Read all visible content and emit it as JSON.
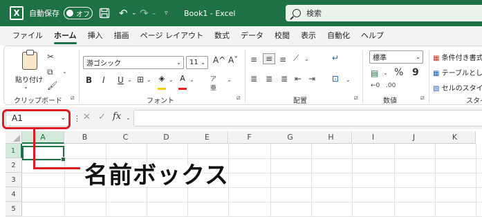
{
  "titlebar": {
    "logo_icon": "excel-logo-icon",
    "autosave_label": "自動保存",
    "autosave_state": "オフ",
    "save_icon": "save-icon",
    "undo_icon": "undo-icon",
    "redo_icon": "redo-icon",
    "book_title": "Book1 - Excel",
    "search_placeholder": "検索",
    "bg_color": "#1e7145"
  },
  "menu": {
    "tabs": [
      {
        "label": "ファイル",
        "active": false
      },
      {
        "label": "ホーム",
        "active": true
      },
      {
        "label": "挿入",
        "active": false
      },
      {
        "label": "描画",
        "active": false
      },
      {
        "label": "ページ レイアウト",
        "active": false
      },
      {
        "label": "数式",
        "active": false
      },
      {
        "label": "データ",
        "active": false
      },
      {
        "label": "校閲",
        "active": false
      },
      {
        "label": "表示",
        "active": false
      },
      {
        "label": "自動化",
        "active": false
      },
      {
        "label": "ヘルプ",
        "active": false
      }
    ]
  },
  "ribbon": {
    "clipboard": {
      "paste_label": "貼り付け",
      "group_label": "クリップボード"
    },
    "font": {
      "font_name": "游ゴシック",
      "font_size": "11",
      "bold": "B",
      "italic": "I",
      "underline": "U",
      "grow": "A^",
      "shrink": "Aˇ",
      "group_label": "フォント"
    },
    "alignment": {
      "group_label": "配置"
    },
    "number": {
      "format": "標準",
      "percent": "%",
      "comma": "9",
      "group_label": "数値"
    },
    "styles": {
      "conditional": "条件付き書式",
      "table": "テーブルとして",
      "cell_style": "セルのスタイル",
      "group_label": "スタイ"
    }
  },
  "formula_bar": {
    "name_box_value": "A1",
    "fx_label": "fx",
    "formula_value": ""
  },
  "grid": {
    "columns": [
      "A",
      "B",
      "C",
      "D",
      "E",
      "F",
      "G",
      "H",
      "I",
      "J",
      "K"
    ],
    "rows": [
      "1",
      "2",
      "3",
      "4",
      "5"
    ],
    "selected_cell": "A1",
    "accent": "#1e7145"
  },
  "callout": {
    "text": "名前ボックス",
    "color": "#e11b22"
  }
}
